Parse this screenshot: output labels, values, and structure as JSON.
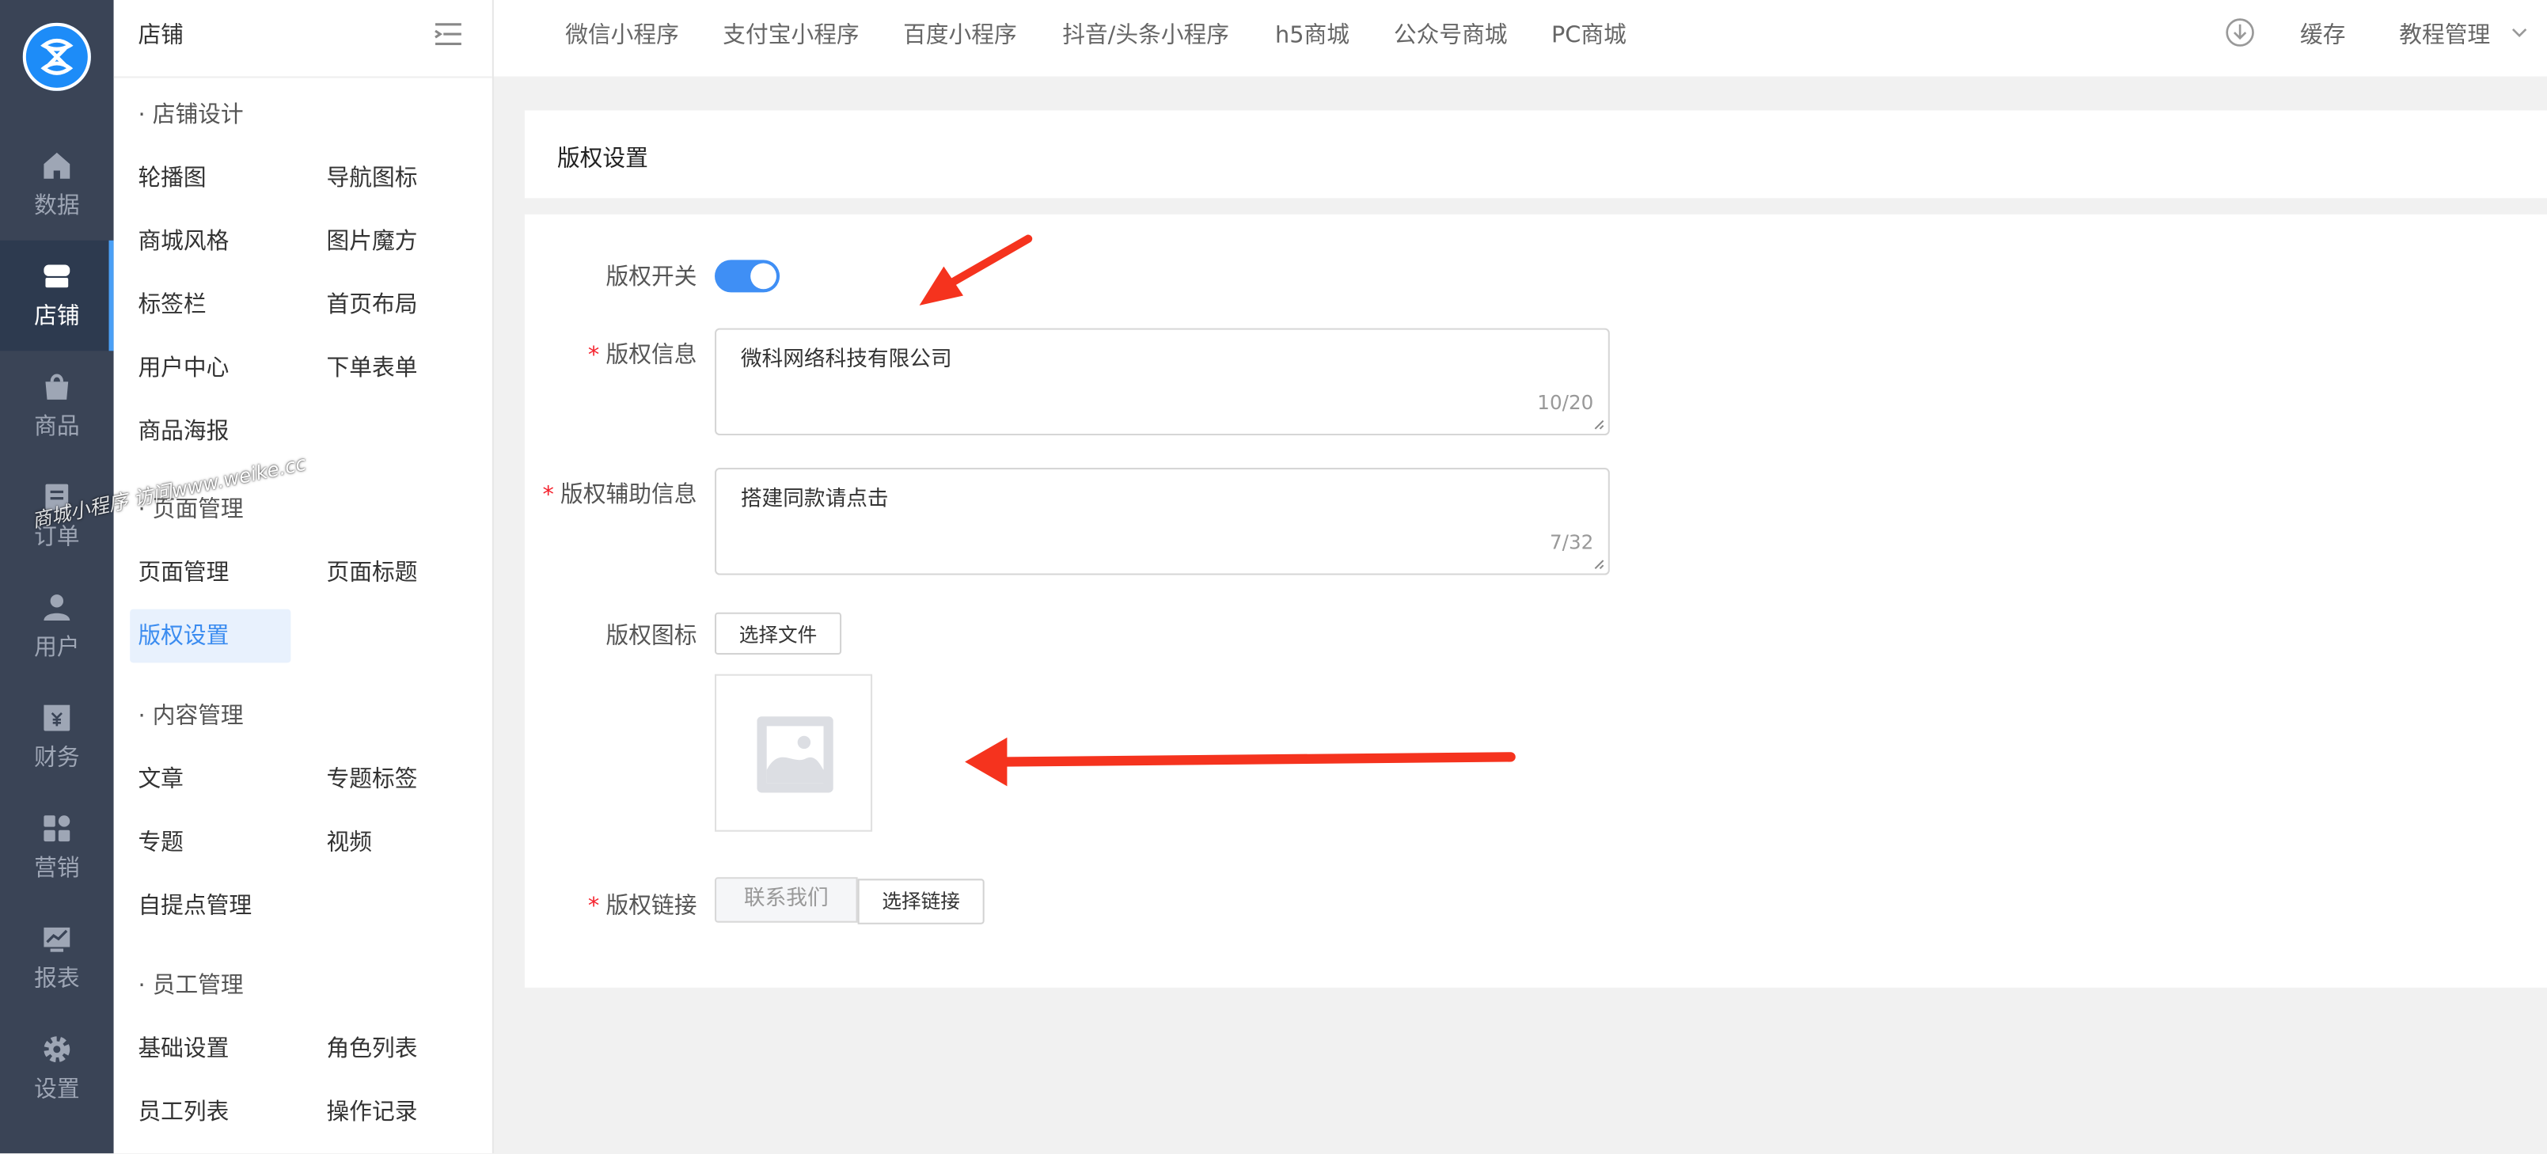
{
  "rail": {
    "items": [
      {
        "label": "数据",
        "icon": "home-icon"
      },
      {
        "label": "店铺",
        "icon": "store-icon"
      },
      {
        "label": "商品",
        "icon": "bag-icon"
      },
      {
        "label": "订单",
        "icon": "order-icon"
      },
      {
        "label": "用户",
        "icon": "user-icon"
      },
      {
        "label": "财务",
        "icon": "yen-icon"
      },
      {
        "label": "营销",
        "icon": "grid-icon"
      },
      {
        "label": "报表",
        "icon": "chart-icon"
      },
      {
        "label": "设置",
        "icon": "gear-icon"
      }
    ],
    "active_color": "#4a9ff5"
  },
  "sidebar": {
    "title": "店铺",
    "sections": [
      {
        "title": "· 店铺设计",
        "items": [
          "轮播图",
          "导航图标",
          "商城风格",
          "图片魔方",
          "标签栏",
          "首页布局",
          "用户中心",
          "下单表单",
          "商品海报"
        ]
      },
      {
        "title": "· 页面管理",
        "items": [
          "页面管理",
          "页面标题",
          "版权设置"
        ]
      },
      {
        "title": "· 内容管理",
        "items": [
          "文章",
          "专题标签",
          "专题",
          "视频",
          "自提点管理"
        ]
      },
      {
        "title": "· 员工管理",
        "items": [
          "基础设置",
          "角色列表",
          "员工列表",
          "操作记录"
        ]
      }
    ],
    "active_item": "版权设置"
  },
  "topbar": {
    "tabs": [
      "微信小程序",
      "支付宝小程序",
      "百度小程序",
      "抖音/头条小程序",
      "h5商城",
      "公众号商城",
      "PC商城"
    ],
    "cache_label": "缓存",
    "user_menu": "教程管理"
  },
  "page": {
    "title": "版权设置"
  },
  "form": {
    "switch_label": "版权开关",
    "switch_on": true,
    "info_label": "版权信息",
    "info_value": "微科网络科技有限公司",
    "info_count": "10/20",
    "aux_label": "版权辅助信息",
    "aux_value": "搭建同款请点击",
    "aux_count": "7/32",
    "icon_label": "版权图标",
    "choose_file": "选择文件",
    "link_label": "版权链接",
    "link_value": "联系我们",
    "choose_link": "选择链接",
    "required_mark": "*",
    "accent_color": "#3f8ff5"
  },
  "watermark": "商城小程序  访问www.weike.cc"
}
